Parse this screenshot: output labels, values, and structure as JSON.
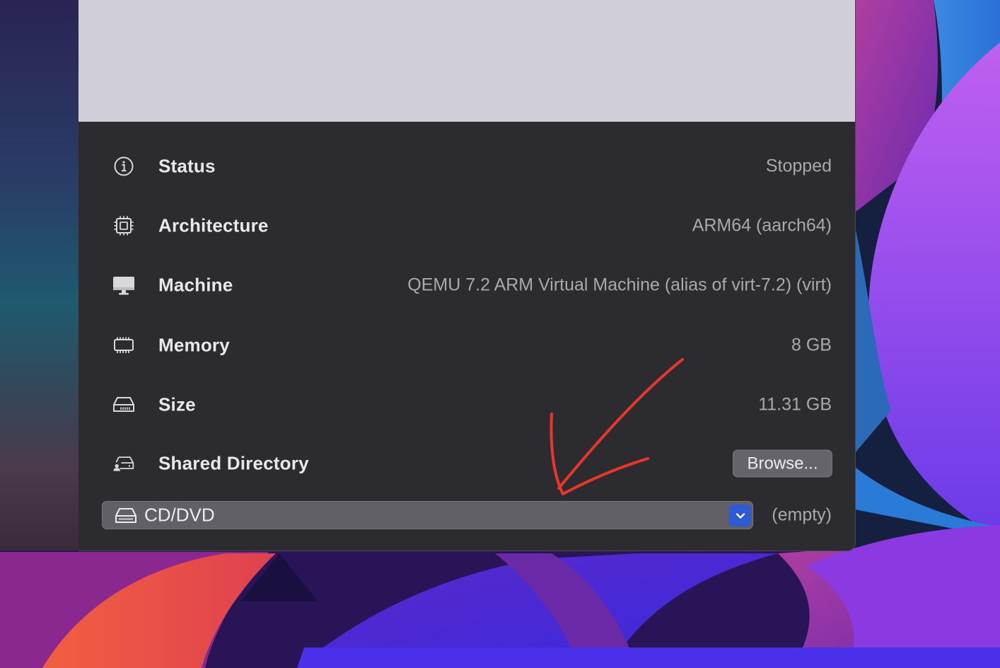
{
  "details": [
    {
      "icon": "info-icon",
      "label": "Status",
      "value": "Stopped"
    },
    {
      "icon": "cpu-icon",
      "label": "Architecture",
      "value": "ARM64 (aarch64)"
    },
    {
      "icon": "display-icon",
      "label": "Machine",
      "value": "QEMU 7.2 ARM Virtual Machine (alias of virt-7.2) (virt)"
    },
    {
      "icon": "memory-icon",
      "label": "Memory",
      "value": "8 GB"
    },
    {
      "icon": "drive-icon",
      "label": "Size",
      "value": "11.31 GB"
    },
    {
      "icon": "shared-drive-icon",
      "label": "Shared Directory",
      "button": "Browse..."
    }
  ],
  "cd_drive": {
    "icon": "drive-icon",
    "label": "CD/DVD",
    "value": "(empty)"
  },
  "colors": {
    "window_bg": "#2c2b30",
    "preview_bg": "#d0cfd8",
    "accent": "#2d5bd6",
    "annotation": "#e8372a"
  }
}
